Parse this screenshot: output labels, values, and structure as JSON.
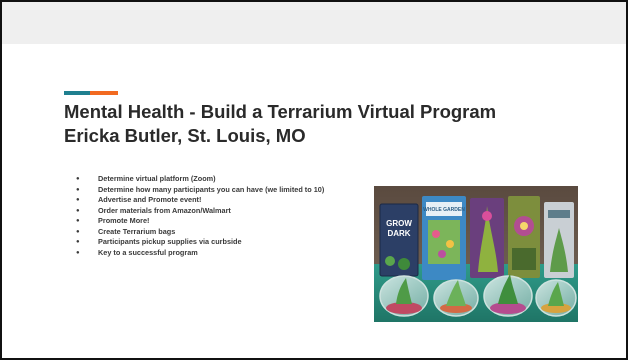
{
  "slide": {
    "title_line1": "Mental Health  - Build a Terrarium Virtual Program",
    "title_line2": "Ericka Butler, St. Louis, MO",
    "bullets": [
      "Determine virtual platform  (Zoom)",
      "Determine how many participants you can have (we limited to 10)",
      "Advertise and Promote event!",
      "Order materials from  Amazon/Walmart",
      "Promote More!",
      "Create Terrarium bags",
      "Participants pickup supplies via curbside",
      "Key to a successful program"
    ]
  },
  "photo": {
    "book_cover_texts": [
      "GROW DARK",
      "WHOLE GARDEN"
    ]
  },
  "colors": {
    "accent_teal": "#1f7f8f",
    "accent_orange": "#f26a21",
    "title": "#2a2a2a",
    "band": "#efefef"
  }
}
